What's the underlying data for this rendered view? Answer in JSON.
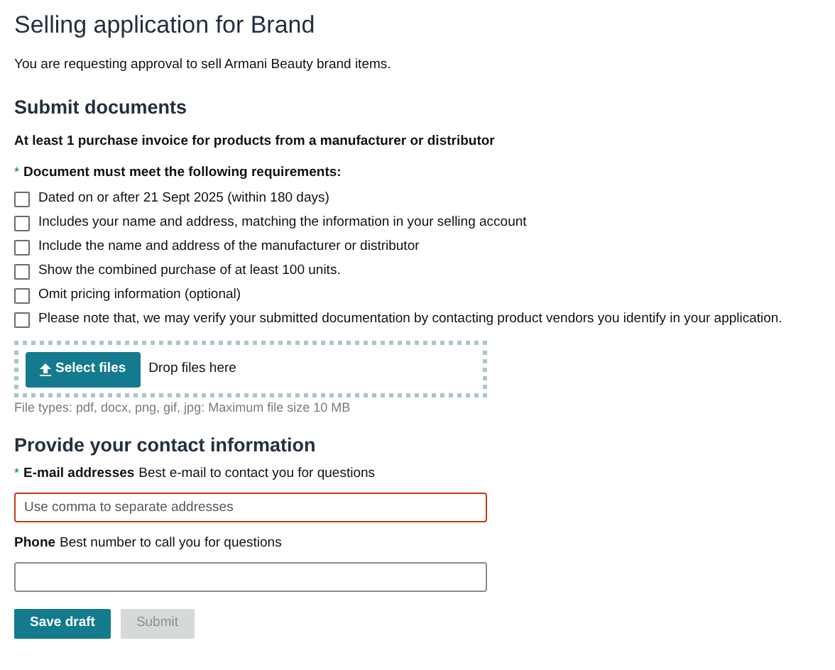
{
  "title": "Selling application for Brand",
  "intro": "You are requesting approval to sell Armani Beauty brand items.",
  "documents": {
    "heading": "Submit documents",
    "subheading": "At least 1 purchase invoice for products from a manufacturer or distributor",
    "requirements_label": {
      "text": "Document must meet the following requirements:",
      "marker": "*"
    },
    "requirements": [
      {
        "label": "Dated on or after 21 Sept 2025 (within 180 days)",
        "checked": false
      },
      {
        "label": "Includes your name and address, matching the information in your selling account",
        "checked": false
      },
      {
        "label": "Include the name and address of the manufacturer or distributor",
        "checked": false
      },
      {
        "label": "Show the combined purchase of at least 100 units.",
        "checked": false
      },
      {
        "label": "Omit pricing information (optional)",
        "checked": false
      },
      {
        "label": "Please note that, we may verify your submitted documentation by contacting product vendors you identify in your application.",
        "checked": false
      }
    ],
    "upload": {
      "button": "Select files",
      "drop_text": "Drop files here",
      "note": "File types: pdf, docx, png, gif, jpg: Maximum file size 10 MB"
    }
  },
  "contact": {
    "heading": "Provide your contact information",
    "fields": [
      {
        "label": "E-mail addresses",
        "hint": "Best e-mail to contact you for questions",
        "marker": "*",
        "placeholder": "Use comma to separate addresses",
        "invalid": true
      },
      {
        "label": "Phone",
        "hint": "Best number to call you for questions",
        "invalid": false
      }
    ]
  },
  "buttons": [
    {
      "label": "Save draft",
      "disabled": false
    },
    {
      "label": "Submit",
      "disabled": true
    }
  ]
}
